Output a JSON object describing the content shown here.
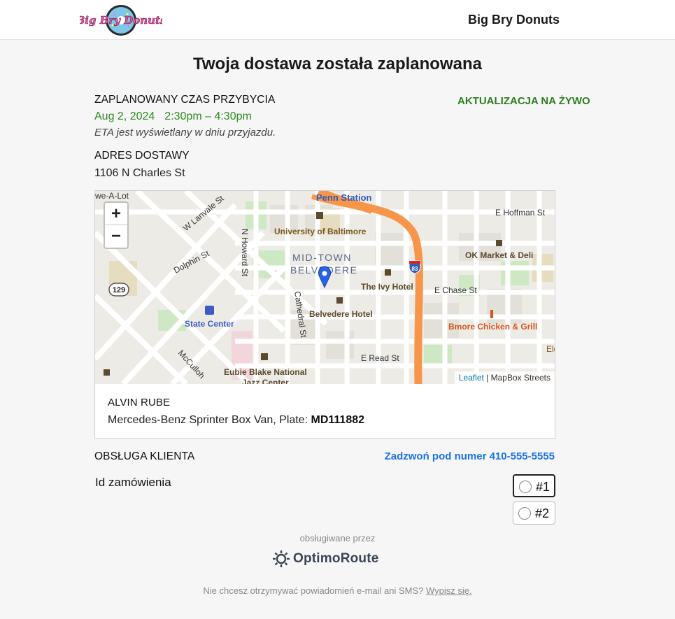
{
  "header": {
    "logo_text": "Big Bry Donuts",
    "brand_name": "Big Bry Donuts"
  },
  "page_title": "Twoja dostawa została zaplanowana",
  "eta": {
    "label": "ZAPLANOWANY CZAS PRZYBYCIA",
    "live_label": "AKTUALIZACJA NA ŻYWO",
    "date": "Aug 2, 2024",
    "time": "2:30pm – 4:30pm",
    "note": "ETA jest wyświetlany w dniu przyjazdu."
  },
  "address": {
    "label": "ADRES DOSTAWY",
    "value": "1106 N Charles St"
  },
  "map": {
    "zoom_in": "+",
    "zoom_out": "−",
    "attribution_link": "Leaflet",
    "attribution_rest": " | MapBox Streets",
    "labels": {
      "penn_station": "Penn Station",
      "university": "University of Baltimore",
      "midtown1": "MID-TOWN",
      "midtown2": "BELVEDERE",
      "ivy_hotel": "The Ivy Hotel",
      "belvedere_hotel": "Belvedere Hotel",
      "state_center": "State Center",
      "eubie1": "Eubie Blake National",
      "eubie2": "Jazz Center",
      "e_chase": "E Chase St",
      "e_read": "E Read St",
      "e_hoffman": "E Hoffman St",
      "ok_market": "OK Market & Deli",
      "bmore": "Bmore Chicken & Grill",
      "n_howard": "N Howard St",
      "cathedral": "Cathedral St",
      "dolphin": "Dolphin St",
      "w_lanvale": "W Lanvale St",
      "mcculloh": "McCulloh",
      "we_a_lot": "we-A-Lot",
      "route_129": "129",
      "route_83": "83",
      "elder": "Elder"
    }
  },
  "driver": {
    "name": "ALVIN RUBE",
    "vehicle_prefix": "Mercedes-Benz Sprinter Box Van, Plate: ",
    "plate": "MD111882"
  },
  "support": {
    "label": "OBSŁUGA KLIENTA",
    "call_text": "Zadzwoń pod numer 410-555-5555"
  },
  "order": {
    "label": "Id zamówienia",
    "options": [
      "#1",
      "#2"
    ]
  },
  "footer": {
    "powered_by": "obsługiwane przez",
    "provider": "OptimoRoute",
    "unsubscribe_text": "Nie chcesz otrzymywać powiadomień e-mail ani SMS? ",
    "unsubscribe_link": "Wypisz się."
  },
  "colors": {
    "eta_green": "#2e8b1f",
    "link_blue": "#1a73e8",
    "highway_orange": "#f7954b",
    "pin_blue": "#2563eb"
  }
}
